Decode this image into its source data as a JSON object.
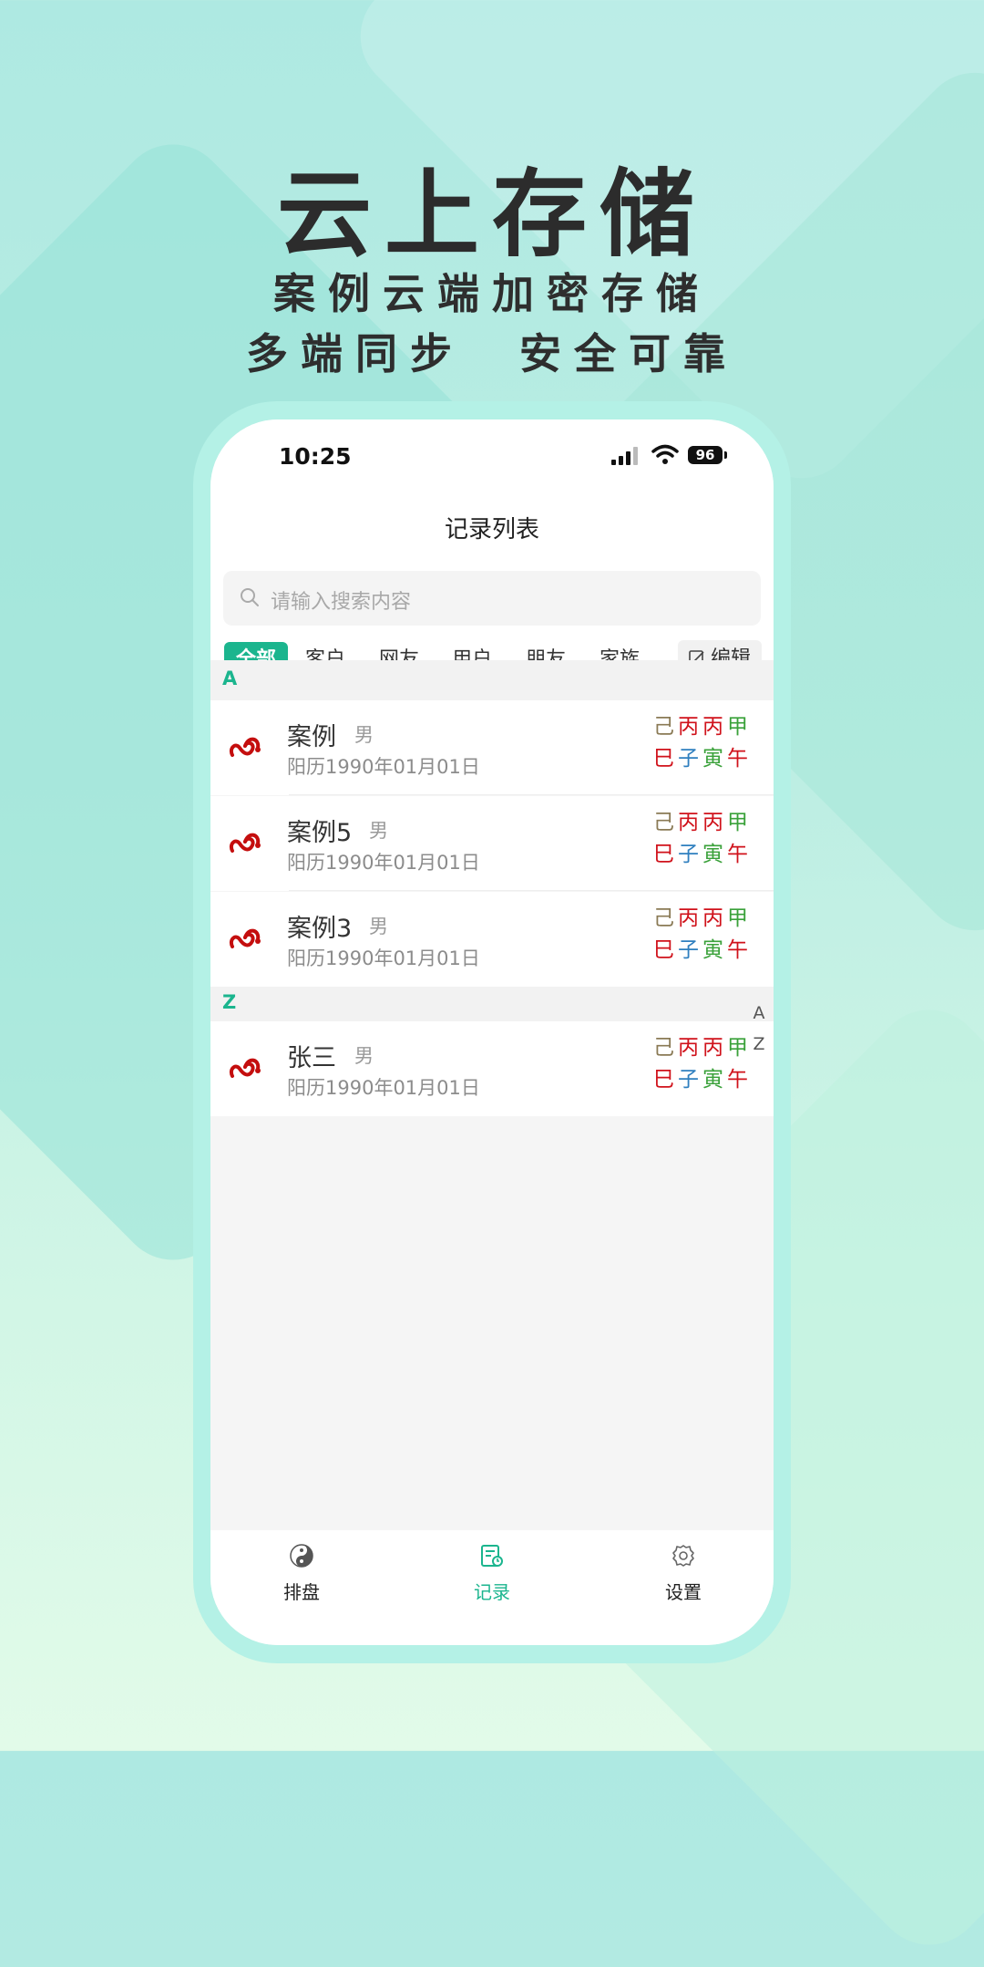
{
  "promo": {
    "headline": "云上存储",
    "sub_line1": "案例云端加密存储",
    "sub_line2": "多端同步  安全可靠"
  },
  "status_bar": {
    "time": "10:25",
    "battery": "96"
  },
  "nav": {
    "title": "记录列表"
  },
  "search": {
    "placeholder": "请输入搜索内容"
  },
  "filter_tabs": [
    {
      "label": "全部",
      "active": true
    },
    {
      "label": "客户",
      "active": false
    },
    {
      "label": "网友",
      "active": false
    },
    {
      "label": "用户",
      "active": false
    },
    {
      "label": "朋友",
      "active": false
    },
    {
      "label": "家族",
      "active": false
    }
  ],
  "edit_label": "编辑",
  "sections": [
    {
      "letter": "A",
      "records": [
        {
          "name": "案例",
          "gender": "男",
          "date": "阳历1990年01月01日",
          "stems": [
            "己",
            "丙",
            "丙",
            "甲"
          ],
          "branches": [
            "巳",
            "子",
            "寅",
            "午"
          ]
        },
        {
          "name": "案例5",
          "gender": "男",
          "date": "阳历1990年01月01日",
          "stems": [
            "己",
            "丙",
            "丙",
            "甲"
          ],
          "branches": [
            "巳",
            "子",
            "寅",
            "午"
          ]
        },
        {
          "name": "案例3",
          "gender": "男",
          "date": "阳历1990年01月01日",
          "stems": [
            "己",
            "丙",
            "丙",
            "甲"
          ],
          "branches": [
            "巳",
            "子",
            "寅",
            "午"
          ]
        }
      ]
    },
    {
      "letter": "Z",
      "records": [
        {
          "name": "张三",
          "gender": "男",
          "date": "阳历1990年01月01日",
          "stems": [
            "己",
            "丙",
            "丙",
            "甲"
          ],
          "branches": [
            "巳",
            "子",
            "寅",
            "午"
          ]
        }
      ]
    }
  ],
  "index_letters": [
    "A",
    "Z"
  ],
  "tabbar": [
    {
      "label": "排盘",
      "icon": "yin-yang-icon",
      "active": false
    },
    {
      "label": "记录",
      "icon": "records-icon",
      "active": true
    },
    {
      "label": "设置",
      "icon": "gear-icon",
      "active": false
    }
  ],
  "colors": {
    "accent": "#1bb58e",
    "earth": "#8a7a55",
    "fire": "#d0121b",
    "wood": "#3aa13a",
    "water": "#2f7fbf"
  }
}
